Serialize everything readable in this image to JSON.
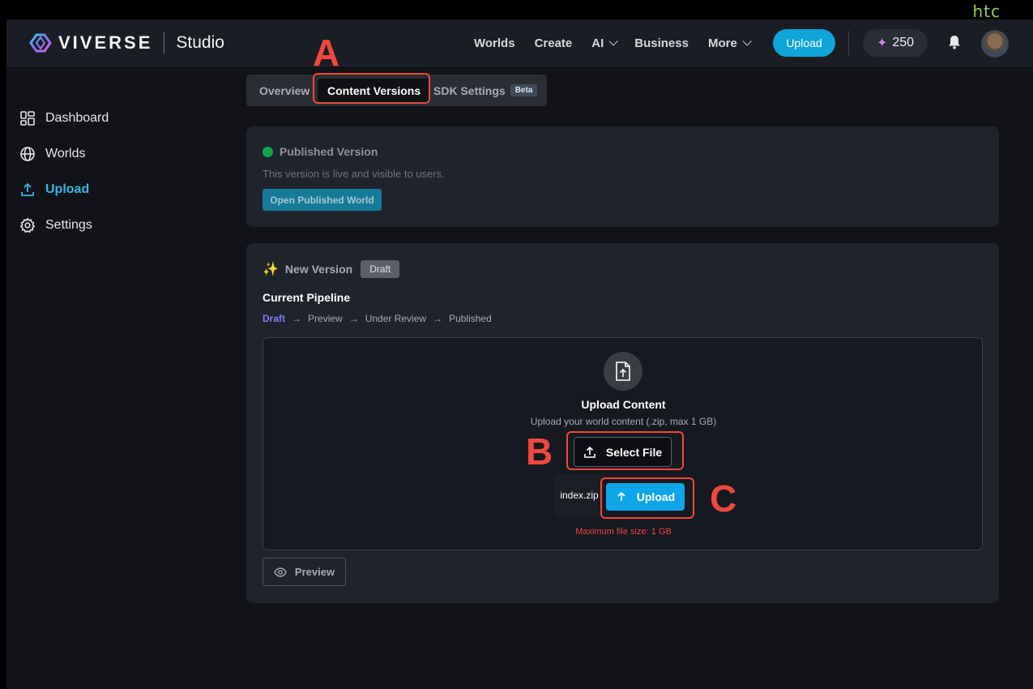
{
  "corner_brand": "htc",
  "header": {
    "logo_text": "VIVERSE",
    "logo_studio": "Studio",
    "nav": [
      {
        "label": "Worlds",
        "dropdown": false
      },
      {
        "label": "Create",
        "dropdown": false
      },
      {
        "label": "AI",
        "dropdown": true
      },
      {
        "label": "Business",
        "dropdown": false
      },
      {
        "label": "More",
        "dropdown": true
      }
    ],
    "upload_label": "Upload",
    "credits": "250",
    "icons": [
      "bell-icon",
      "avatar"
    ]
  },
  "sidebar": {
    "items": [
      {
        "label": "Dashboard",
        "icon": "dashboard-icon",
        "active": false
      },
      {
        "label": "Worlds",
        "icon": "globe-icon",
        "active": false
      },
      {
        "label": "Upload",
        "icon": "upload-icon",
        "active": true
      },
      {
        "label": "Settings",
        "icon": "gear-icon",
        "active": false
      }
    ]
  },
  "tabs": {
    "items": [
      {
        "label": "Overview"
      },
      {
        "label": "Content Versions",
        "active": true
      },
      {
        "label": "SDK Settings",
        "badge": "Beta"
      }
    ]
  },
  "published": {
    "title": "Published Version",
    "description": "This version is live and visible to users.",
    "open_button": "Open Published World"
  },
  "new_version": {
    "title": "New Version",
    "badge": "Draft",
    "pipeline_title": "Current Pipeline",
    "pipeline": [
      "Draft",
      "Preview",
      "Under Review",
      "Published"
    ],
    "pipeline_current": "Draft",
    "arrow": "→",
    "upload": {
      "title": "Upload Content",
      "subtitle": "Upload your world content (.zip, max 1 GB)",
      "select_button": "Select File",
      "file_name": "index.zip",
      "upload_button": "Upload",
      "max_size": "Maximum file size: 1 GB"
    },
    "preview_button": "Preview"
  },
  "annotations": {
    "a": "A",
    "b": "B",
    "c": "C",
    "color": "#f0483e"
  },
  "colors": {
    "accent": "#0ea5d8",
    "active_nav": "#36b6e6",
    "published_dot": "#16a34a",
    "pipeline_current": "#7f7cf4",
    "error": "#ef4444"
  }
}
